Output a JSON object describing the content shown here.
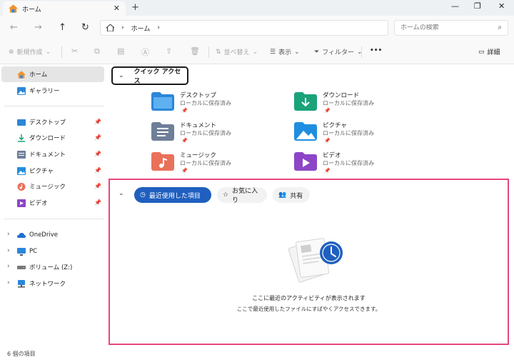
{
  "window": {
    "tab_title": "ホーム",
    "tab_close": "✕",
    "new_tab": "+",
    "minimize": "—",
    "maximize": "❐",
    "close": "✕"
  },
  "nav": {
    "back": "←",
    "forward": "→",
    "up": "↑",
    "refresh": "↻",
    "breadcrumb_sep": "›",
    "breadcrumb": [
      "ホーム"
    ],
    "search_placeholder": "ホームの検索"
  },
  "toolbar": {
    "new_label": "新規作成",
    "sort_label": "並べ替え",
    "view_label": "表示",
    "filter_label": "フィルター",
    "more_label": "•••",
    "details_label": "詳細"
  },
  "sidebar": {
    "items": [
      {
        "label": "ホーム",
        "icon": "home-icon"
      },
      {
        "label": "ギャラリー",
        "icon": "gallery-icon"
      },
      {
        "label": "デスクトップ",
        "icon": "desktop-icon"
      },
      {
        "label": "ダウンロード",
        "icon": "download-icon"
      },
      {
        "label": "ドキュメント",
        "icon": "documents-icon"
      },
      {
        "label": "ピクチャ",
        "icon": "pictures-icon"
      },
      {
        "label": "ミュージック",
        "icon": "music-icon"
      },
      {
        "label": "ビデオ",
        "icon": "videos-icon"
      },
      {
        "label": "OneDrive",
        "icon": "onedrive-icon"
      },
      {
        "label": "PC",
        "icon": "pc-icon"
      },
      {
        "label": "ボリューム (Z:)",
        "icon": "drive-icon"
      },
      {
        "label": "ネットワーク",
        "icon": "network-icon"
      }
    ],
    "pin_glyph": "📌"
  },
  "quick_access": {
    "title": "クイック アクセス",
    "items": [
      {
        "name": "デスクトップ",
        "sub": "ローカルに保存済み",
        "color": "#2b86d9"
      },
      {
        "name": "ダウンロード",
        "sub": "ローカルに保存済み",
        "color": "#1aa37a"
      },
      {
        "name": "ドキュメント",
        "sub": "ローカルに保存済み",
        "color": "#6f7f98"
      },
      {
        "name": "ピクチャ",
        "sub": "ローカルに保存済み",
        "color": "#1f8ee0"
      },
      {
        "name": "ミュージック",
        "sub": "ローカルに保存済み",
        "color": "#e9715a"
      },
      {
        "name": "ビデオ",
        "sub": "ローカルに保存済み",
        "color": "#8d45c7"
      }
    ]
  },
  "recent": {
    "tabs": [
      "最近使用した項目",
      "お気に入り",
      "共有"
    ],
    "empty_title": "ここに最近のアクティビティが表示されます",
    "empty_sub": "ここで最近使用したファイルにすばやくアクセスできます。"
  },
  "status": {
    "count_text": "6 個の項目"
  },
  "colors": {
    "accent": "#1f5fbf",
    "highlight": "#e8477a"
  }
}
